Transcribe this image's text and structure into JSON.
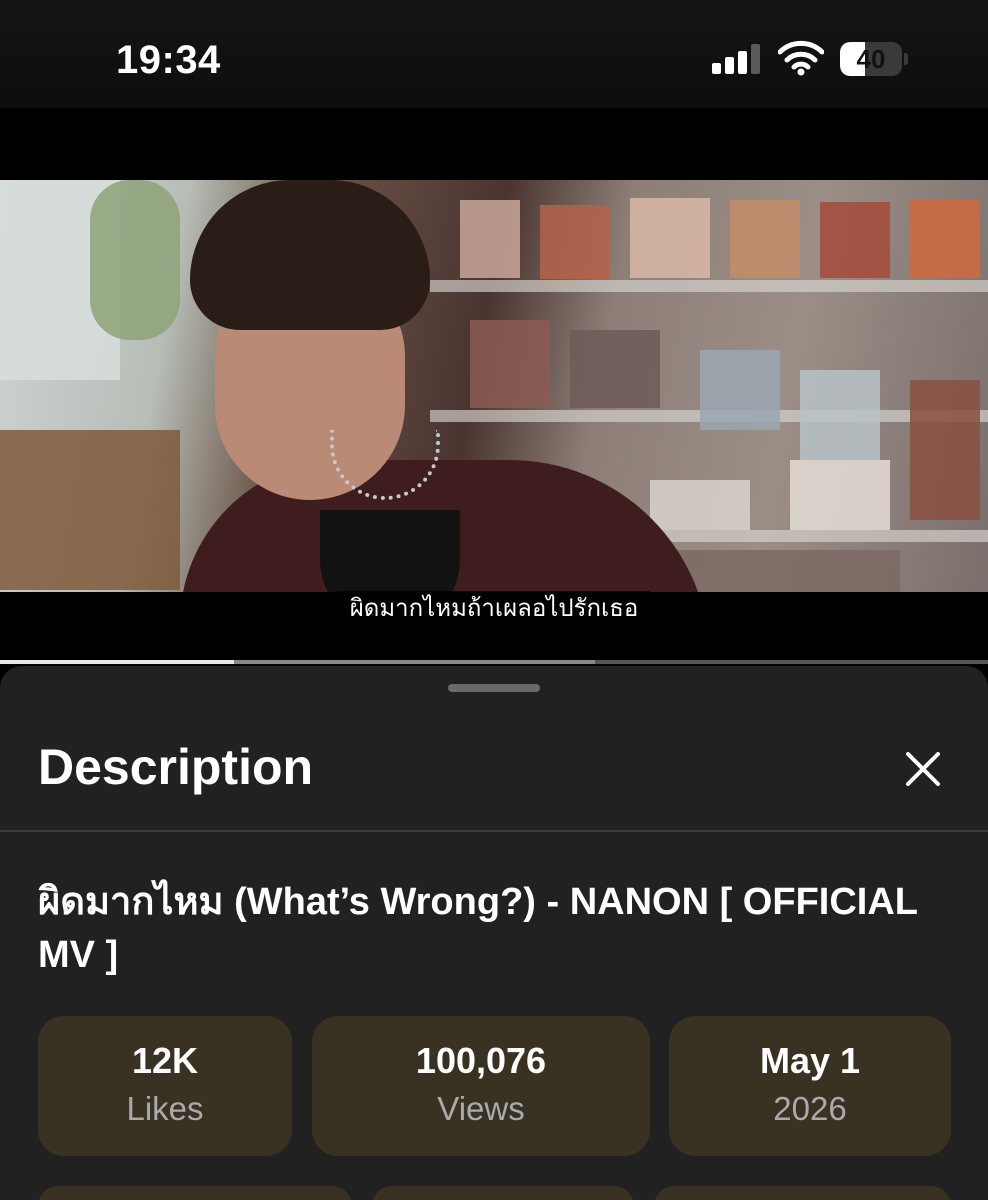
{
  "status_bar": {
    "time": "19:34",
    "battery_level": "40",
    "icons": [
      "signal-icon",
      "wifi-icon",
      "battery-icon"
    ]
  },
  "video": {
    "subtitle": "ผิดมากไหมถ้าเผลอไปรักเธอ",
    "progress_fraction": 0.237,
    "buffer_fraction": 0.602
  },
  "panel": {
    "title": "Description",
    "close_icon": "close-icon",
    "video_title": "ผิดมากไหม (What’s Wrong?) - NANON [ OFFICIAL MV ]"
  },
  "stats": [
    {
      "value": "12K",
      "label": "Likes"
    },
    {
      "value": "100,076",
      "label": "Views"
    },
    {
      "value": "May 1",
      "label": "2026"
    }
  ],
  "colors": {
    "panel_bg": "#212121",
    "card_bg": "#393121",
    "progress": "#e8e8e8"
  }
}
